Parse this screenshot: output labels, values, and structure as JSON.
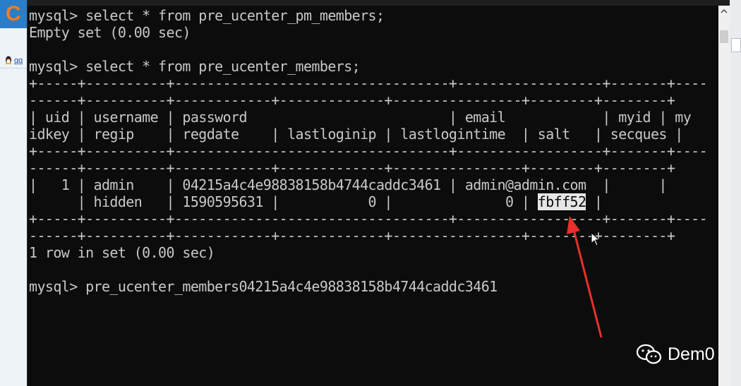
{
  "desktop": {
    "logo_letter": "C",
    "qq_link_text": "qq"
  },
  "console": {
    "lines": [
      "mysql> select * from pre_ucenter_pm_members;",
      "Empty set (0.00 sec)",
      "",
      "mysql> select * from pre_ucenter_members;",
      "+-----+----------+----------------------------------+------------------+-------+----",
      "------+----------+------------+-------------+----------------+--------+--------+",
      "| uid | username | password                         | email            | myid | my",
      "idkey | regip    | regdate    | lastloginip | lastlogintime  | salt   | secques |",
      "+-----+----------+----------------------------------+------------------+-------+----",
      "------+----------+------------+-------------+----------------+--------+--------+",
      "|   1 | admin    | 04215a4c4e98838158b4744caddc3461 | admin@admin.com  |      |",
      "      | hidden   | 1590595631 |           0 |              0 | ",
      "+-----+----------+----------------------------------+------------------+-------+----",
      "------+----------+------------+-------------+----------------+--------+--------+",
      "1 row in set (0.00 sec)",
      "",
      "mysql> pre_ucenter_members04215a4c4e98838158b4744caddc3461"
    ],
    "highlighted_value": "fbff52",
    "after_highlight": " |"
  },
  "watermark": {
    "text": "Dem0",
    "icon": "wechat-icon"
  },
  "colors": {
    "console_bg": "#0c0c0c",
    "console_text": "#c8c8c8",
    "annotation_arrow": "#e8302a"
  }
}
